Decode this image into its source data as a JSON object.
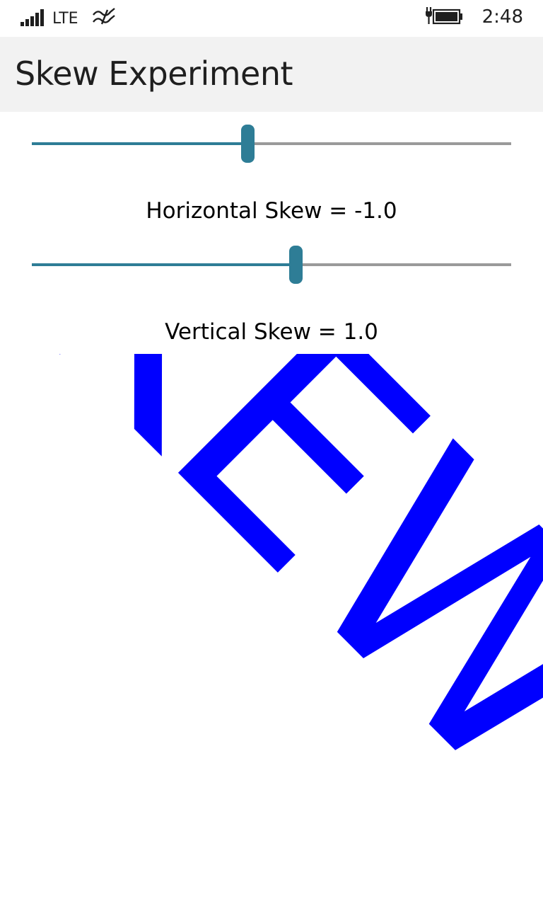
{
  "status_bar": {
    "signal_icon": "signal-strength-icon",
    "network": "LTE",
    "data_icon": "data-transfer-icon",
    "battery_icon": "battery-charging-icon",
    "time": "2:48"
  },
  "app": {
    "title": "Skew Experiment"
  },
  "sliders": {
    "horizontal": {
      "fraction": 0.45,
      "label": "Horizontal Skew = -1.0"
    },
    "vertical": {
      "fraction": 0.55,
      "label": "Vertical Skew = 1.0"
    }
  },
  "skew_text": {
    "text": "SKEW",
    "color": "#0000ff",
    "horizontal_skew": -1.0,
    "vertical_skew": 1.0
  },
  "colors": {
    "accent": "#2e7d96",
    "track": "#9a9a9a",
    "title_bar": "#f2f2f2"
  }
}
